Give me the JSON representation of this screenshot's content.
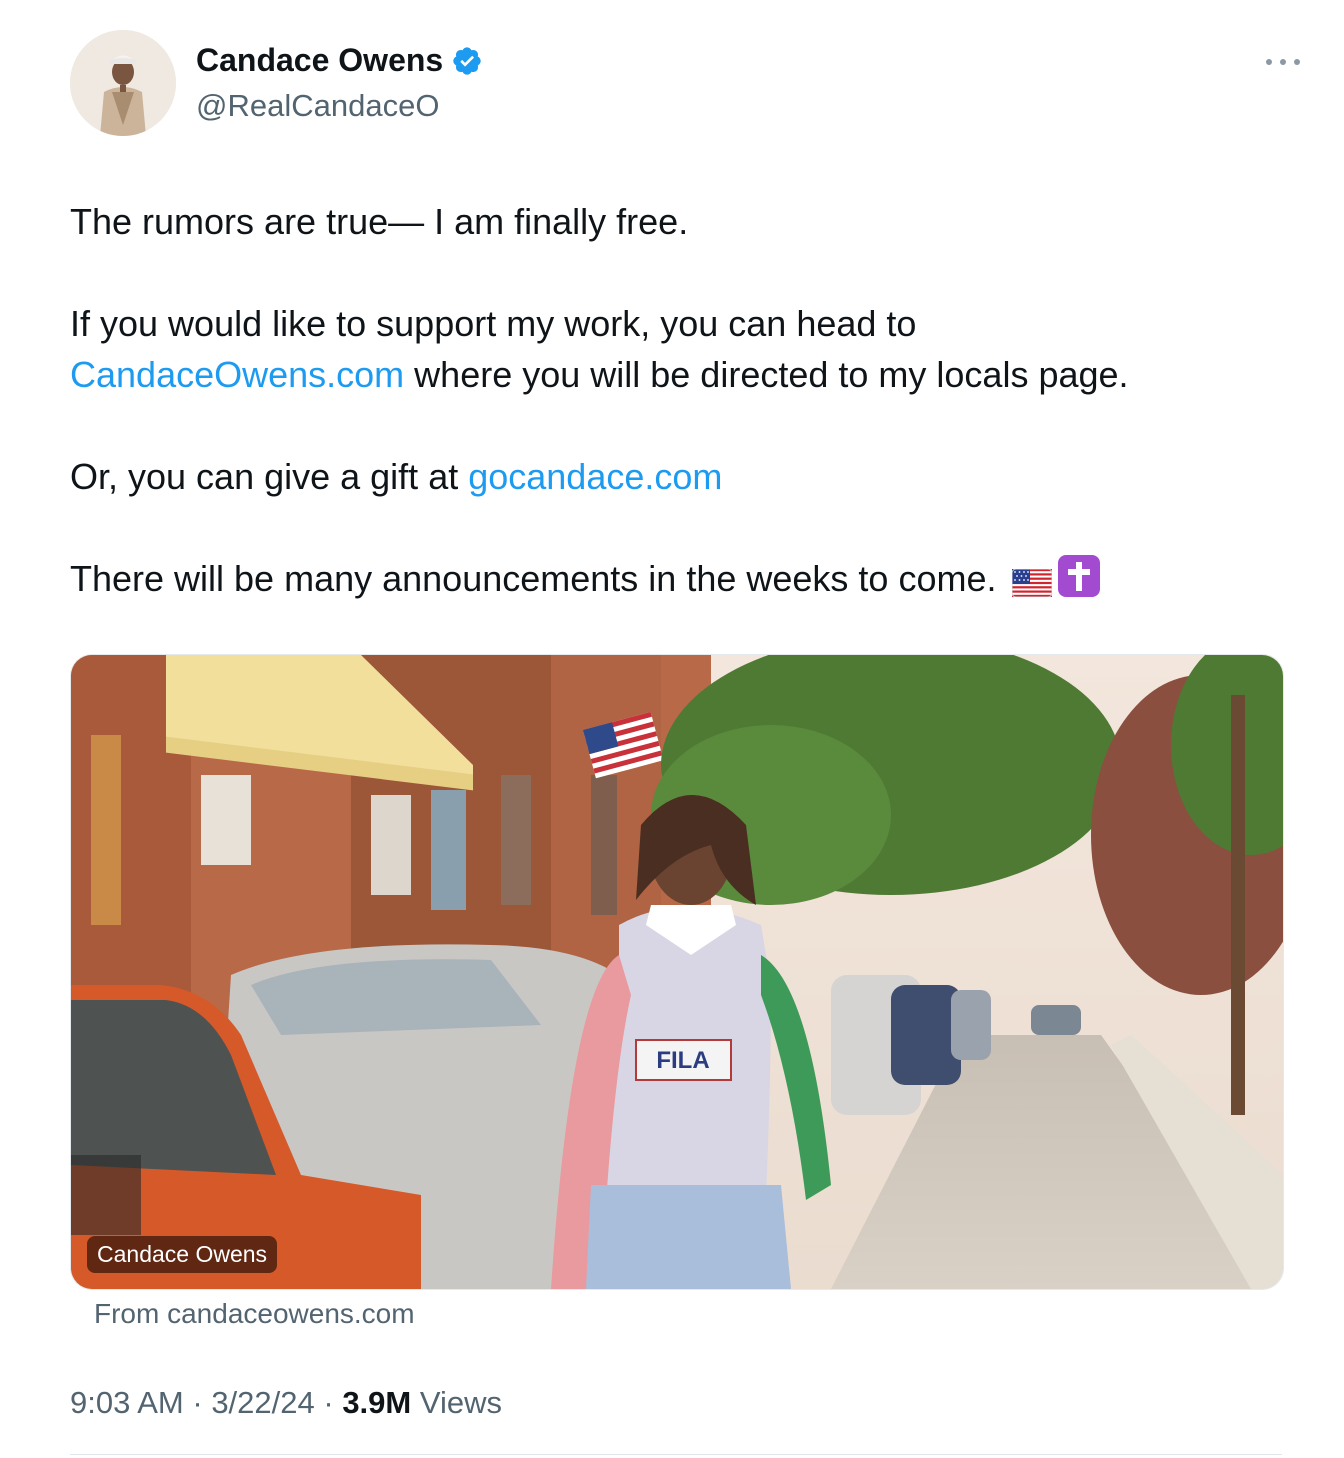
{
  "author": {
    "display_name": "Candace Owens",
    "handle": "@RealCandaceO",
    "verified": true,
    "avatar_icon": "profile-photo-avatar",
    "verified_icon": "verified-badge-icon"
  },
  "more_icon": "more-options-icon",
  "tweet": {
    "line1": "The rumors are true— I am finally free.",
    "line2": "If you would like to support my work, you can head to",
    "link1": "CandaceOwens.com",
    "line3_rest": " where you will be directed to my locals page.",
    "line4_prefix": "Or, you can give a gift at ",
    "link2": "gocandace.com",
    "line5": "There will be many announcements in the weeks to come. ",
    "emojis": [
      "us-flag-emoji",
      "latin-cross-emoji"
    ]
  },
  "media": {
    "badge": "Candace Owens",
    "from": "From candaceowens.com"
  },
  "meta": {
    "time": "9:03 AM",
    "sep1": " · ",
    "date": "3/22/24",
    "sep2": " · ",
    "views_count": "3.9M",
    "views_label": " Views"
  },
  "colors": {
    "link": "#1d9bf0",
    "verified": "#1d9bf0",
    "secondary_text": "#536471",
    "primary_text": "#0f1419"
  }
}
